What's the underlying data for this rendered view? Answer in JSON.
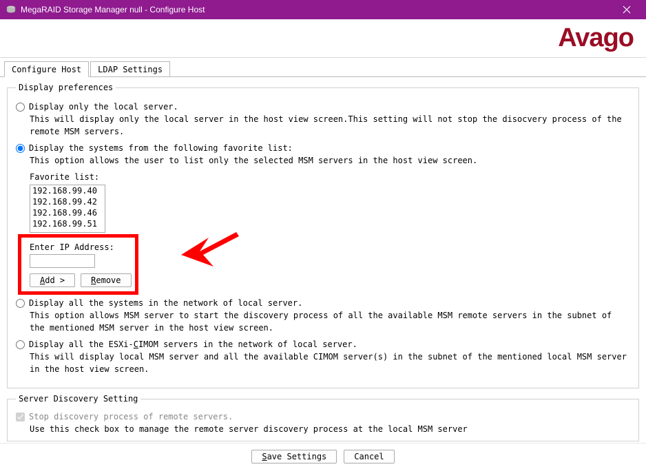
{
  "window": {
    "title": "MegaRAID Storage Manager null - Configure Host"
  },
  "logo": {
    "text": "Avago"
  },
  "tabs": {
    "configure": "Configure Host",
    "ldap": "LDAP Settings"
  },
  "display_prefs": {
    "legend": "Display preferences",
    "opt_local": {
      "label": "Display only the local server.",
      "desc": "This will display only the local server in the host view screen.This setting will not stop the disocvery process of the remote MSM servers."
    },
    "opt_favorite": {
      "label": "Display the systems from the following favorite list:",
      "desc": "This option allows the user to list only the selected MSM servers in the host view screen.",
      "fav_label": "Favorite list:",
      "list": [
        "192.168.99.40",
        "192.168.99.42",
        "192.168.99.46",
        "192.168.99.51"
      ],
      "ip_label": "Enter IP Address:",
      "ip_value": "",
      "add_btn": "Add >",
      "remove_btn": "Remove"
    },
    "opt_all_local": {
      "label": "Display all the systems in the network of local server.",
      "desc": "This option allows MSM server to start the discovery process of all the available MSM remote servers in the subnet of the mentioned MSM server in the host view screen."
    },
    "opt_esxi": {
      "label_pre": "Display all the ESXi-",
      "label_mn": "C",
      "label_post": "IMOM servers in the network of local server.",
      "desc": "This will display local MSM server and all the available CIMOM server(s) in the subnet of the mentioned local MSM server in the host view screen."
    }
  },
  "server_discovery": {
    "legend": "Server Discovery Setting",
    "stop_label": "Stop discovery process of remote servers.",
    "stop_desc": "Use this check box to manage the remote server discovery process at the local MSM server"
  },
  "footer": {
    "save_mn": "S",
    "save_post": "ave Settings",
    "cancel": "Cancel"
  }
}
